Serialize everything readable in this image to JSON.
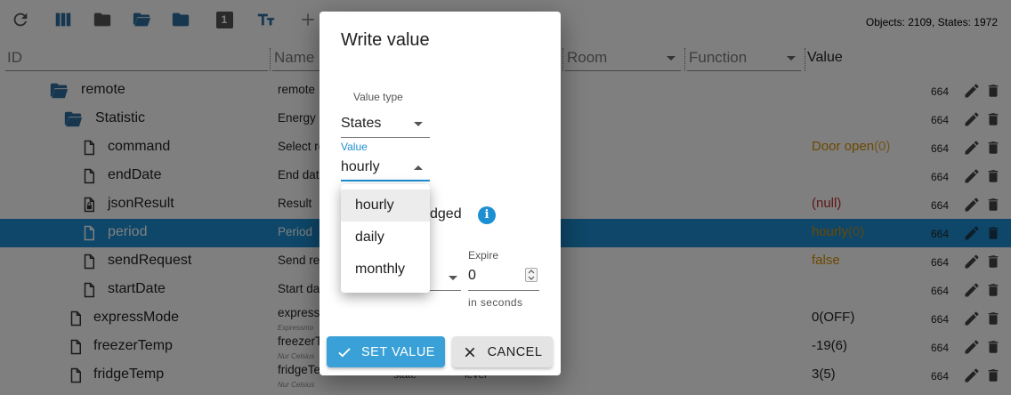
{
  "status": {
    "objects": "Objects: 2109, States: 1972"
  },
  "toolbar": {
    "icons": [
      "refresh-icon",
      "columns-icon",
      "folder-icon",
      "folder-open-icon",
      "folder-icon",
      "badge-1-icon",
      "text-size-icon",
      "add-icon"
    ],
    "badge_number": "1"
  },
  "columns": {
    "id": "ID",
    "name": "Name",
    "room": "Room",
    "function": "Function",
    "value": "Value"
  },
  "rows": [
    {
      "name": "remote",
      "desc": "remote",
      "sub": "",
      "value": "",
      "num": "664",
      "type": "folder-open"
    },
    {
      "name": "Statistic",
      "desc": "Energy",
      "sub": "",
      "value": "",
      "num": "664",
      "type": "folder-open"
    },
    {
      "name": "command",
      "desc": "Select re",
      "sub": "",
      "value": "Door open",
      "value_suffix": "(0)",
      "num": "664",
      "type": "file",
      "vc": "or"
    },
    {
      "name": "endDate",
      "desc": "End dat",
      "sub": "",
      "value": "",
      "num": "664",
      "type": "file"
    },
    {
      "name": "jsonResult",
      "desc": "Result",
      "sub": "",
      "value": "(null)",
      "num": "664",
      "type": "file-lock",
      "vc": "rd"
    },
    {
      "name": "period",
      "desc": "Period",
      "sub": "",
      "value": "hourly",
      "value_suffix": "(0)",
      "num": "664",
      "type": "file",
      "vc": "or",
      "selected": true
    },
    {
      "name": "sendRequest",
      "desc": "Send re",
      "sub": "",
      "value": "false",
      "num": "664",
      "type": "file",
      "vc": "or"
    },
    {
      "name": "startDate",
      "desc": "Start da",
      "sub": "",
      "value": "",
      "num": "664",
      "type": "file"
    },
    {
      "name": "expressMode",
      "desc": "expressM",
      "sub": "Expressmo",
      "value": "0(OFF)",
      "num": "664",
      "type": "file",
      "vc": "bk"
    },
    {
      "name": "freezerTemp",
      "desc": "freezerT",
      "sub": "Nur Celsius",
      "value": "-19(6)",
      "num": "664",
      "type": "file",
      "vc": "bk"
    },
    {
      "name": "fridgeTemp",
      "desc": "fridgeTe",
      "sub": "Nur Celsius",
      "value": "3(5)",
      "num": "664",
      "type": "file",
      "vc": "bk",
      "extra": [
        "state",
        "level"
      ]
    }
  ],
  "dialog": {
    "title": "Write value",
    "value_type_label": "Value type",
    "value_type": "States",
    "value_label": "Value",
    "value": "hourly",
    "ack_label_partial": "dged",
    "expire_label": "Expire",
    "expire_value": "0",
    "expire_helper": "in seconds",
    "set_button": "SET VALUE",
    "cancel_button": "CANCEL",
    "options": [
      "hourly",
      "daily",
      "monthly"
    ],
    "highlighted_option": "hourly"
  },
  "colors": {
    "accent": "#1c8fd2",
    "button_primary": "#39a0d8",
    "value_orange": "#d99000",
    "value_red": "#c03030",
    "toolbar_icon": "#2d6f9e"
  }
}
